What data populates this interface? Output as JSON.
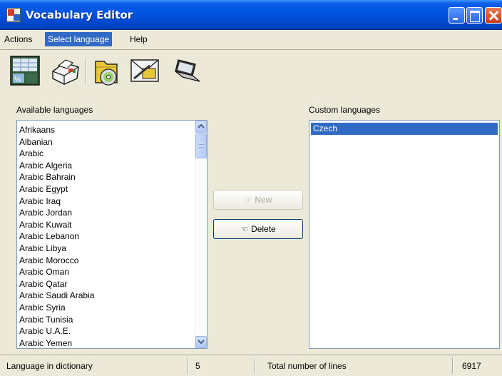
{
  "window": {
    "title": "Vocabulary Editor"
  },
  "menu": {
    "items": [
      "Actions",
      "Select language",
      "Help"
    ]
  },
  "toolbar": {
    "icons": [
      "spreadsheet-icon",
      "printer-icon",
      "folder-cd-icon",
      "email-icon",
      "laptop-icon"
    ]
  },
  "available": {
    "label": "Available languages",
    "items": [
      "Afrikaans",
      "Albanian",
      "Arabic",
      "Arabic Algeria",
      "Arabic Bahrain",
      "Arabic Egypt",
      "Arabic Iraq",
      "Arabic Jordan",
      "Arabic Kuwait",
      "Arabic Lebanon",
      "Arabic Libya",
      "Arabic Morocco",
      "Arabic Oman",
      "Arabic Qatar",
      "Arabic Saudi Arabia",
      "Arabic Syria",
      "Arabic Tunisia",
      "Arabic U.A.E.",
      "Arabic Yemen"
    ]
  },
  "custom": {
    "label": "Custom languages",
    "items": [
      "Czech"
    ],
    "selected": "Czech"
  },
  "buttons": {
    "new_label": "New",
    "delete_label": "Delete"
  },
  "status": {
    "language_label": "Language in dictionary",
    "language_count": "5",
    "lines_label": "Total number of lines",
    "lines_count": "6917"
  }
}
